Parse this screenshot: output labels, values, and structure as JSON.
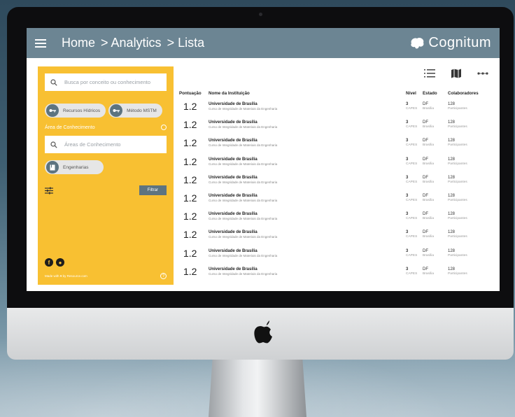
{
  "header": {
    "crumbs": [
      "Home",
      "> Analytics",
      "> Lista"
    ],
    "brand": "Cognitum"
  },
  "sidebar": {
    "search_placeholder": "Busca por conceito ou conhecimento",
    "chips": [
      "Recursos Hídricos",
      "Método MSTM"
    ],
    "area_title": "Área de Conhecimento",
    "area_placeholder": "Áreas de Conhecimento",
    "area_chip": "Engenharias",
    "filter_label": "Filtrar",
    "made_with": "Made with ♥ by Resource.com"
  },
  "table": {
    "headers": [
      "Pontuação",
      "Nome da Instituição",
      "Nível",
      "Estado",
      "Colaboradores"
    ],
    "rows": [
      {
        "score": "1.2",
        "name": "Universidade de Brasília",
        "sub": "Curso de Integridade de Materiais da Engenharia",
        "level": "3",
        "level_sub": "CAPES",
        "state": "DF",
        "state_sub": "Brasília",
        "collab": "128",
        "collab_sub": "Participantes"
      },
      {
        "score": "1.2",
        "name": "Universidade de Brasília",
        "sub": "Curso de Integridade de Materiais da Engenharia",
        "level": "3",
        "level_sub": "CAPES",
        "state": "DF",
        "state_sub": "Brasília",
        "collab": "128",
        "collab_sub": "Participantes"
      },
      {
        "score": "1.2",
        "name": "Universidade de Brasília",
        "sub": "Curso de Integridade de Materiais da Engenharia",
        "level": "3",
        "level_sub": "CAPES",
        "state": "DF",
        "state_sub": "Brasília",
        "collab": "128",
        "collab_sub": "Participantes"
      },
      {
        "score": "1.2",
        "name": "Universidade de Brasília",
        "sub": "Curso de Integridade de Materiais da Engenharia",
        "level": "3",
        "level_sub": "CAPES",
        "state": "DF",
        "state_sub": "Brasília",
        "collab": "128",
        "collab_sub": "Participantes"
      },
      {
        "score": "1.2",
        "name": "Universidade de Brasília",
        "sub": "Curso de Integridade de Materiais da Engenharia",
        "level": "3",
        "level_sub": "CAPES",
        "state": "DF",
        "state_sub": "Brasília",
        "collab": "128",
        "collab_sub": "Participantes"
      },
      {
        "score": "1.2",
        "name": "Universidade de Brasília",
        "sub": "Curso de Integridade de Materiais da Engenharia",
        "level": "3",
        "level_sub": "CAPES",
        "state": "DF",
        "state_sub": "Brasília",
        "collab": "128",
        "collab_sub": "Participantes"
      },
      {
        "score": "1.2",
        "name": "Universidade de Brasília",
        "sub": "Curso de Integridade de Materiais da Engenharia",
        "level": "3",
        "level_sub": "CAPES",
        "state": "DF",
        "state_sub": "Brasília",
        "collab": "128",
        "collab_sub": "Participantes"
      },
      {
        "score": "1.2",
        "name": "Universidade de Brasília",
        "sub": "Curso de Integridade de Materiais da Engenharia",
        "level": "3",
        "level_sub": "CAPES",
        "state": "DF",
        "state_sub": "Brasília",
        "collab": "128",
        "collab_sub": "Participantes"
      },
      {
        "score": "1.2",
        "name": "Universidade de Brasília",
        "sub": "Curso de Integridade de Materiais da Engenharia",
        "level": "3",
        "level_sub": "CAPES",
        "state": "DF",
        "state_sub": "Brasília",
        "collab": "128",
        "collab_sub": "Participantes"
      },
      {
        "score": "1.2",
        "name": "Universidade de Brasília",
        "sub": "Curso de Integridade de Materiais da Engenharia",
        "level": "3",
        "level_sub": "CAPES",
        "state": "DF",
        "state_sub": "Brasília",
        "collab": "128",
        "collab_sub": "Participantes"
      }
    ]
  },
  "colors": {
    "topbar": "#6c8593",
    "sidebar": "#f8c032",
    "accent": "#5d7480"
  },
  "icons": [
    "hamburger-icon",
    "cognitum-logo-icon",
    "search-icon",
    "key-icon",
    "info-icon",
    "book-icon",
    "sliders-icon",
    "facebook-icon",
    "github-icon",
    "help-icon",
    "list-view-icon",
    "map-view-icon",
    "more-icon",
    "apple-logo-icon"
  ]
}
